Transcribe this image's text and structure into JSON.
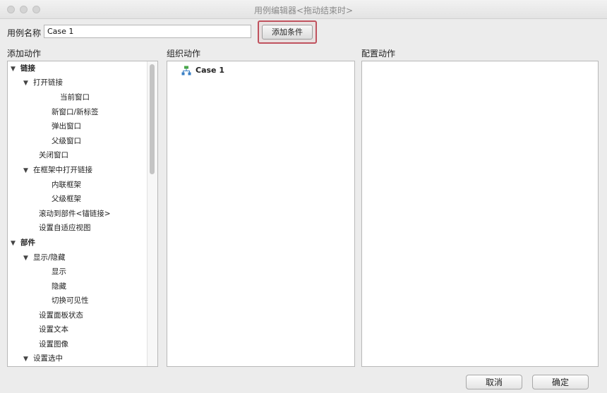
{
  "window": {
    "title": "用例编辑器<拖动结束时>"
  },
  "header": {
    "case_name_label": "用例名称",
    "case_name_value": "Case 1",
    "add_condition_label": "添加条件"
  },
  "sections": {
    "add_actions": "添加动作",
    "organize_actions": "组织动作",
    "configure_actions": "配置动作"
  },
  "action_tree": [
    {
      "label": "链接",
      "expanded": true
    },
    {
      "label": "打开链接",
      "expanded": true
    },
    {
      "label": "当前窗口"
    },
    {
      "label": "新窗口/新标签"
    },
    {
      "label": "弹出窗口"
    },
    {
      "label": "父级窗口"
    },
    {
      "label": "关闭窗口"
    },
    {
      "label": "在框架中打开链接",
      "expanded": true
    },
    {
      "label": "内联框架"
    },
    {
      "label": "父级框架"
    },
    {
      "label": "滚动到部件<锚链接>"
    },
    {
      "label": "设置自适应视图"
    },
    {
      "label": "部件",
      "expanded": true
    },
    {
      "label": "显示/隐藏",
      "expanded": true
    },
    {
      "label": "显示"
    },
    {
      "label": "隐藏"
    },
    {
      "label": "切换可见性"
    },
    {
      "label": "设置面板状态"
    },
    {
      "label": "设置文本"
    },
    {
      "label": "设置图像"
    },
    {
      "label": "设置选中",
      "expanded": true
    }
  ],
  "organize": {
    "case_label": "Case 1"
  },
  "footer": {
    "cancel_label": "取消",
    "ok_label": "确定"
  }
}
